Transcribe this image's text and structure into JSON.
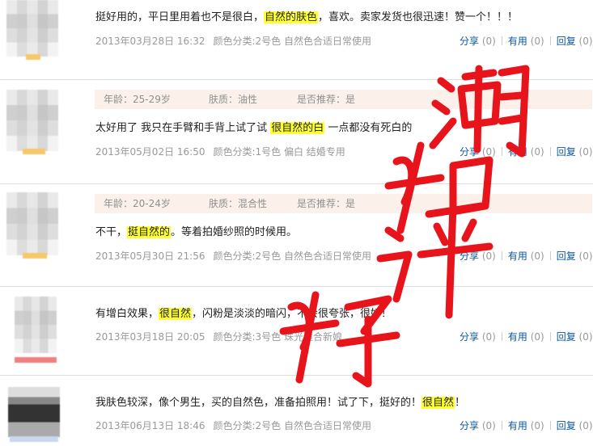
{
  "reviews": [
    {
      "has_attrs": false,
      "content_pre": "挺好用的，平日里用着也不是很白，",
      "highlight": "自然的肤色",
      "content_post": "，喜欢。卖家发货也很迅速！赞一个！！！",
      "date": "2013年03月28日 16:32",
      "category": "颜色分类:2号色 自然色合适日常使用",
      "share_label": "分享",
      "share_count": "(0)",
      "useful_label": "有用",
      "useful_count": "(0)",
      "reply_label": "回复",
      "reply_count": "(0)"
    },
    {
      "has_attrs": true,
      "age": "年龄：25-29岁",
      "skin": "肤质：油性",
      "recommend": "是否推荐：是",
      "content_pre": "太好用了 我只在手臂和手背上试了试 ",
      "highlight": "很自然的白",
      "content_post": " 一点都没有死白的",
      "date": "2013年05月02日 16:50",
      "category": "颜色分类:1号色 偏白 结婚专用",
      "share_label": "分享",
      "share_count": "(0)",
      "useful_label": "有用",
      "useful_count": "(0)",
      "reply_label": "回复",
      "reply_count": "(0)"
    },
    {
      "has_attrs": true,
      "age": "年龄：20-24岁",
      "skin": "肤质：混合性",
      "recommend": "是否推荐：是",
      "content_pre": "不干，",
      "highlight": "挺自然的",
      "content_post": "。等着拍婚纱照的时候用。",
      "date": "2013年05月30日 21:56",
      "category": "颜色分类:2号色 自然色合适日常使用",
      "share_label": "分享",
      "share_count": "(0)",
      "useful_label": "有用",
      "useful_count": "(0)",
      "reply_label": "回复",
      "reply_count": "(0)"
    },
    {
      "has_attrs": false,
      "content_pre": "有增白效果，",
      "highlight": "很自然",
      "content_post": "，闪粉是淡淡的暗闪，不会很夸张，很好！",
      "date": "2013年03月18日 20:05",
      "category": "颜色分类:3号色 珠光适合新娘",
      "share_label": "分享",
      "share_count": "(0)",
      "useful_label": "有用",
      "useful_count": "(0)",
      "reply_label": "回复",
      "reply_count": "(0)"
    },
    {
      "has_attrs": false,
      "content_pre": "我肤色较深，像个男生，买的自然色，准备拍照用！试了下，挺好的！",
      "highlight": "很自然",
      "content_post": "！",
      "date": "2013年06月13日 18:46",
      "category": "颜色分类:2号色 自然色合适日常使用",
      "share_label": "分享",
      "share_count": "(0)",
      "useful_label": "有用",
      "useful_count": "(0)",
      "reply_label": "回复",
      "reply_count": "(0)"
    }
  ],
  "watermark": {
    "text": "好评如潮",
    "color": "#e8141b"
  }
}
